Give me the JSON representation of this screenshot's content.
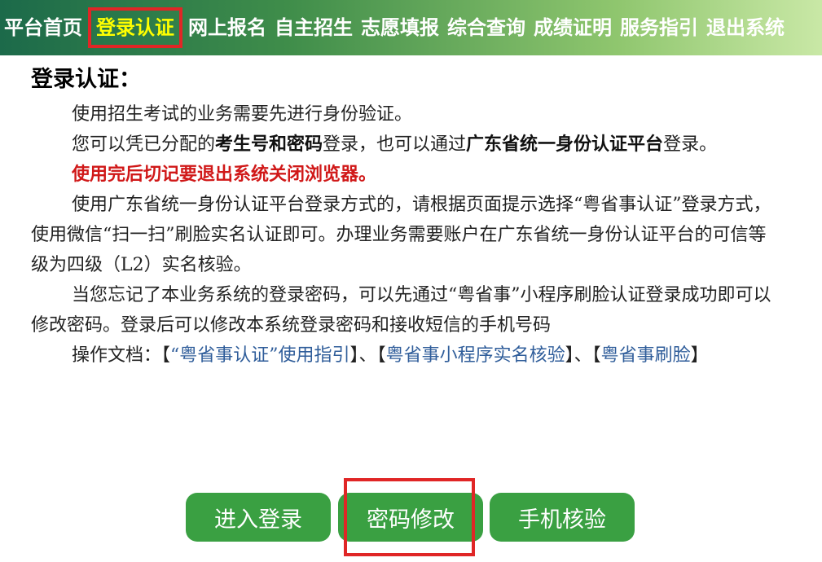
{
  "nav": {
    "items": [
      "平台首页",
      "登录认证",
      "网上报名",
      "自主招生",
      "志愿填报",
      "综合查询",
      "成绩证明",
      "服务指引",
      "退出系统"
    ],
    "active_index": 1
  },
  "content": {
    "heading": "登录认证：",
    "p1": "使用招生考试的业务需要先进行身份验证。",
    "p2_a": "您可以凭已分配的",
    "p2_b": "考生号和密码",
    "p2_c": "登录，也可以通过",
    "p2_d": "广东省统一身份认证平台",
    "p2_e": "登录。",
    "warning": "使用完后切记要退出系统关闭浏览器。",
    "p3": "使用广东省统一身份认证平台登录方式的，请根据页面提示选择“粤省事认证”登录方式，使用微信“扫一扫”刷脸实名认证即可。办理业务需要账户在广东省统一身份认证平台的可信等级为四级（L2）实名核验。",
    "p4": "当您忘记了本业务系统的登录密码，可以先通过“粤省事”小程序刷脸认证登录成功即可以修改密码。登录后可以修改本系统登录密码和接收短信的手机号码",
    "docs_label": "操作文档：",
    "docs": [
      {
        "open": "【",
        "text": "“粤省事认证”使用指引",
        "close": "】"
      },
      {
        "sep": "、"
      },
      {
        "open": "【",
        "text": "粤省事小程序实名核验",
        "close": "】"
      },
      {
        "sep": "、"
      },
      {
        "open": "【",
        "text": "粤省事刷脸",
        "close": "】"
      }
    ]
  },
  "buttons": {
    "login": "进入登录",
    "change_password": "密码修改",
    "phone_verify": "手机核验"
  },
  "colors": {
    "nav_start": "#1c6a4a",
    "nav_end": "#c9e8a6",
    "active_text": "#ffff00",
    "highlight": "#e02626",
    "warning": "#d01818",
    "link": "#2f5d9a",
    "button": "#3aa042"
  }
}
